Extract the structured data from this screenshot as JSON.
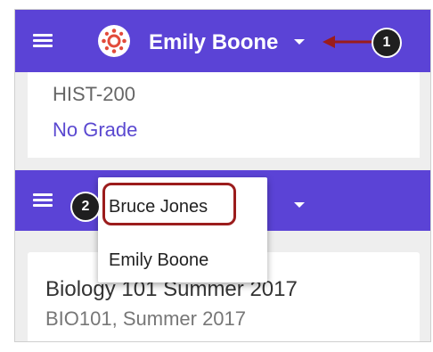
{
  "header": {
    "user_name": "Emily Boone",
    "menu_icon": "hamburger-icon",
    "dropdown_icon": "caret-down-icon",
    "avatar_icon": "canvas-logo-icon"
  },
  "course_card": {
    "code": "HIST-200",
    "grade": "No Grade"
  },
  "user_menu": {
    "items": [
      "Bruce Jones",
      "Emily Boone"
    ]
  },
  "course_card_2": {
    "title": "Biology 101 Summer 2017",
    "subtitle": "BIO101, Summer 2017"
  },
  "callouts": {
    "step1": "1",
    "step2": "2"
  },
  "colors": {
    "appbar": "#5b43d6",
    "highlight": "#9b1c1c",
    "link": "#5a48d0"
  }
}
